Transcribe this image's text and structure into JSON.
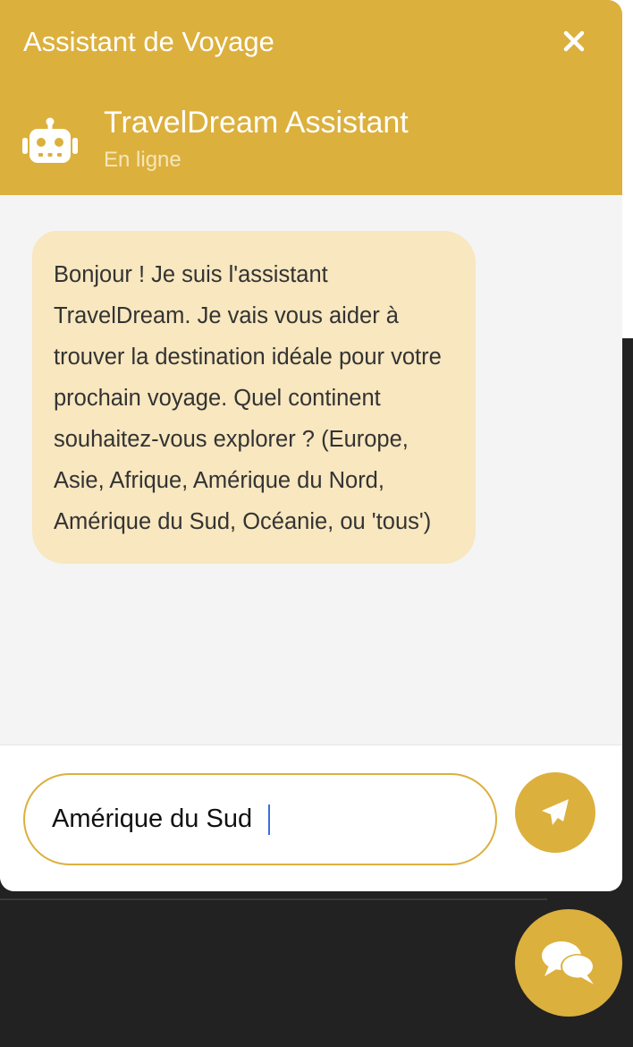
{
  "header": {
    "title": "Assistant de Voyage",
    "close_icon": "close-icon"
  },
  "bot": {
    "name": "TravelDream Assistant",
    "status": "En ligne",
    "avatar_icon": "robot-icon"
  },
  "messages": [
    {
      "sender": "bot",
      "text": "Bonjour ! Je suis l'assistant TravelDream. Je vais vous aider à trouver la destination idéale pour votre prochain voyage. Quel continent souhaitez-vous explorer ? (Europe, Asie, Afrique, Amérique du Nord, Amérique du Sud, Océanie, ou 'tous')"
    }
  ],
  "input": {
    "value": "Amérique du Sud",
    "send_icon": "paper-plane-icon"
  },
  "launcher": {
    "icon": "chat-bubbles-icon"
  },
  "colors": {
    "accent": "#dcb03d",
    "bubble": "#f8e7bf",
    "dark_background": "#222222"
  }
}
